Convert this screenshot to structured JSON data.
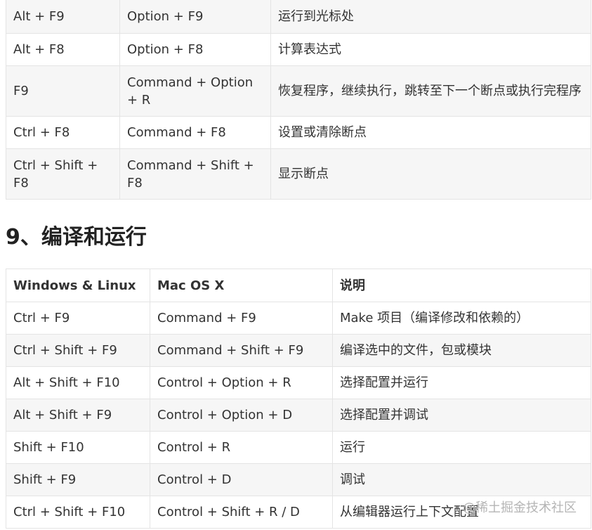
{
  "debug_table": {
    "rows": [
      {
        "windows": "Alt + F9",
        "mac": "Option + F9",
        "desc": "运行到光标处"
      },
      {
        "windows": "Alt + F8",
        "mac": "Option + F8",
        "desc": "计算表达式"
      },
      {
        "windows": "F9",
        "mac": "Command + Option + R",
        "desc": "恢复程序，继续执行，跳转至下一个断点或执行完程序"
      },
      {
        "windows": "Ctrl + F8",
        "mac": "Command + F8",
        "desc": "设置或清除断点"
      },
      {
        "windows": "Ctrl + Shift + F8",
        "mac": "Command + Shift + F8",
        "desc": "显示断点"
      }
    ]
  },
  "section": {
    "heading": "9、编译和运行"
  },
  "run_table": {
    "headers": {
      "windows": "Windows & Linux",
      "mac": "Mac OS X",
      "desc": "说明"
    },
    "rows": [
      {
        "windows": "Ctrl + F9",
        "mac": "Command + F9",
        "desc": "Make 项目（编译修改和依赖的）"
      },
      {
        "windows": "Ctrl + Shift + F9",
        "mac": "Command + Shift + F9",
        "desc": "编译选中的文件，包或模块"
      },
      {
        "windows": "Alt + Shift + F10",
        "mac": "Control + Option + R",
        "desc": "选择配置并运行"
      },
      {
        "windows": "Alt + Shift + F9",
        "mac": "Control + Option + D",
        "desc": "选择配置并调试"
      },
      {
        "windows": "Shift + F10",
        "mac": "Control + R",
        "desc": "运行"
      },
      {
        "windows": "Shift + F9",
        "mac": "Control + D",
        "desc": "调试"
      },
      {
        "windows": "Ctrl + Shift + F10",
        "mac": "Control + Shift + R / D",
        "desc": "从编辑器运行上下文配置"
      }
    ]
  },
  "watermark": "@稀土掘金技术社区"
}
